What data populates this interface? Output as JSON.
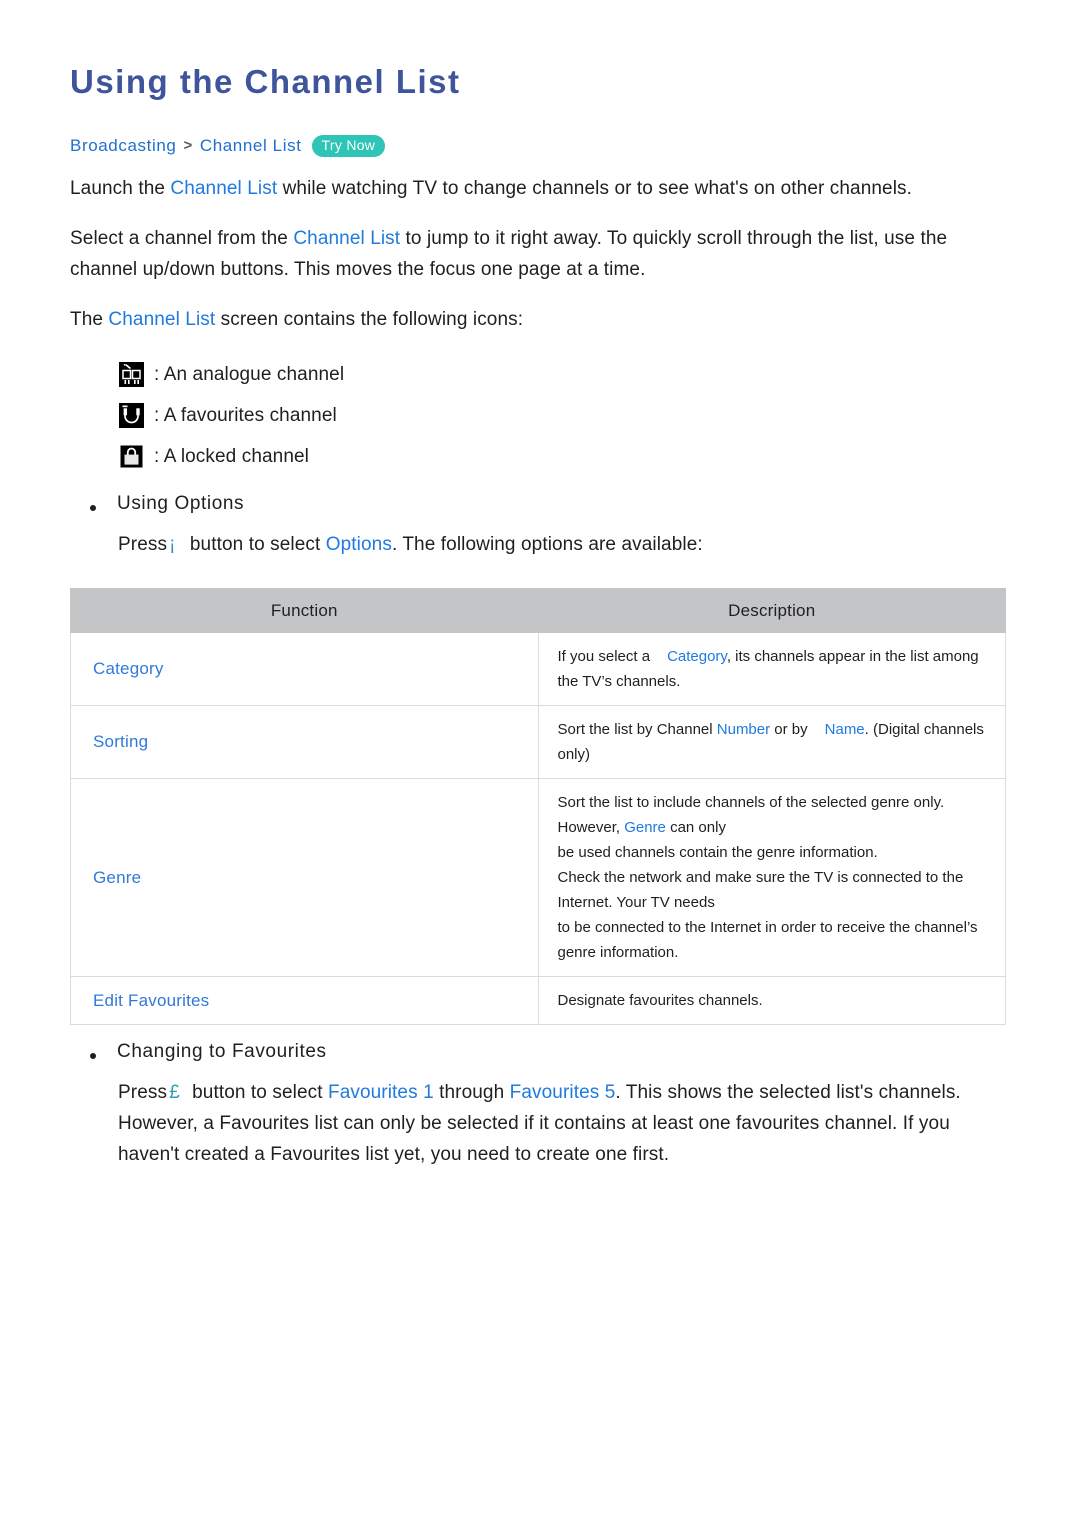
{
  "title": "Using the Channel List",
  "breadcrumb": {
    "root": "Broadcasting",
    "separator": ">",
    "leaf": "Channel List",
    "badge": "Try Now"
  },
  "paragraphs": {
    "p1_a": "Launch the ",
    "p1_link": "Channel List",
    "p1_b": " while watching TV to change channels or to see what's on other channels.",
    "p2_a": "Select a channel from the ",
    "p2_link": "Channel List",
    "p2_b": " to jump to it right away. To quickly scroll through the list, use the channel up/down buttons. This moves the focus one page at a time.",
    "p3_a": "The ",
    "p3_link": "Channel List",
    "p3_b": " screen contains the following icons:"
  },
  "icon_legend": [
    {
      "icon": "analogue-channel-icon",
      "label": ": An analogue channel"
    },
    {
      "icon": "favourites-channel-icon",
      "label": ": A favourites channel"
    },
    {
      "icon": "locked-channel-icon",
      "label": ": A locked channel"
    }
  ],
  "using_options": {
    "heading": "Using Options",
    "press_a": "Press",
    "symbol": "¡",
    "press_b": " button to select ",
    "options_link": "Options",
    "press_c": ". The following options are available:"
  },
  "table": {
    "headers": [
      "Function",
      "Description"
    ],
    "rows": [
      {
        "function": "Category",
        "lines": [
          {
            "pre": "If you select a",
            "link": "Category",
            "post": ", its channels appear in the list among the TV’s channels."
          }
        ]
      },
      {
        "function": "Sorting",
        "lines": [
          {
            "pre": "Sort the list by Channel ",
            "link": "Number",
            "mid": " or by",
            "link2": "Name",
            "post": ". (Digital channels only)"
          }
        ]
      },
      {
        "function": "Genre",
        "lines": [
          {
            "pre": "Sort the list to include channels of the selected genre only. However, ",
            "link": "Genre",
            "post": " can only"
          },
          {
            "pre": "be used channels contain the genre information."
          },
          {
            "pre": "Check the network and make sure the TV is connected to the Internet. Your TV needs"
          },
          {
            "pre": "to be connected to the Internet in order to receive the channel’s genre information."
          }
        ]
      },
      {
        "function": "Edit Favourites",
        "lines": [
          {
            "pre": "Designate favourites channels."
          }
        ]
      }
    ]
  },
  "changing_favourites": {
    "heading": "Changing to Favourites",
    "press_a": "Press",
    "symbol": "£",
    "press_b": " button to select ",
    "link1": "Favourites 1",
    "mid": " through ",
    "link2": "Favourites 5",
    "post": ". This shows the selected list's channels. However, a Favourites list can only be selected if it contains at least one favourites channel. If you haven't created a Favourites list yet, you need to create one first."
  },
  "colors": {
    "title": "#3f559b",
    "link": "#1f7ae0",
    "badge": "#2ec4b6",
    "table_header_bg": "#c4c5c7"
  }
}
